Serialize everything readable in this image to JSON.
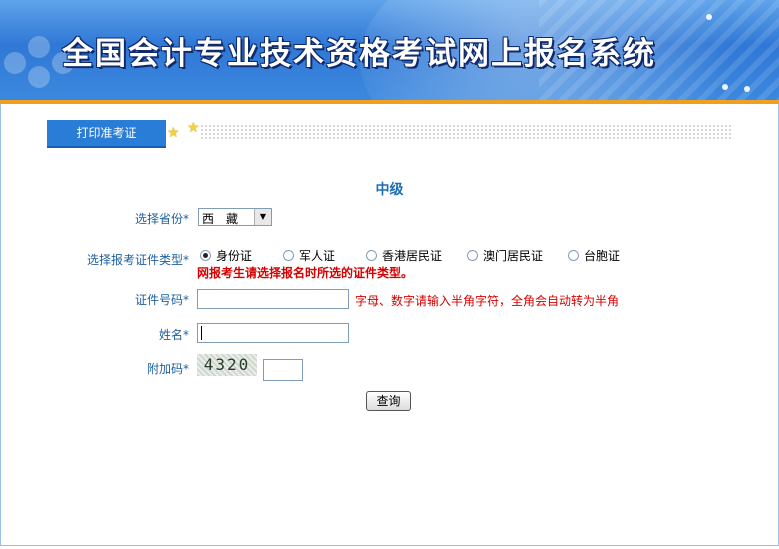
{
  "header": {
    "title": "全国会计专业技术资格考试网上报名系统"
  },
  "tab": {
    "label": "打印准考证"
  },
  "level": "中级",
  "form": {
    "province_label": "选择省份",
    "required_mark": "*",
    "province_value": "西　藏",
    "id_type_label": "选择报考证件类型",
    "id_types": [
      "身份证",
      "军人证",
      "香港居民证",
      "澳门居民证",
      "台胞证"
    ],
    "id_type_selected": "身份证",
    "id_type_warning": "网报考生请选择报名时所选的证件类型。",
    "id_number_label": "证件号码",
    "id_number_hint": "字母、数字请输入半角字符，全角会自动转为半角",
    "name_label": "姓名",
    "captcha_label": "附加码",
    "captcha_text": "4320",
    "submit_label": "查询"
  },
  "colors": {
    "banner": "#3c88de",
    "accent": "#f0a021",
    "tab": "#2a7dd7",
    "label": "#1e5f9c",
    "warning": "#d60000"
  }
}
